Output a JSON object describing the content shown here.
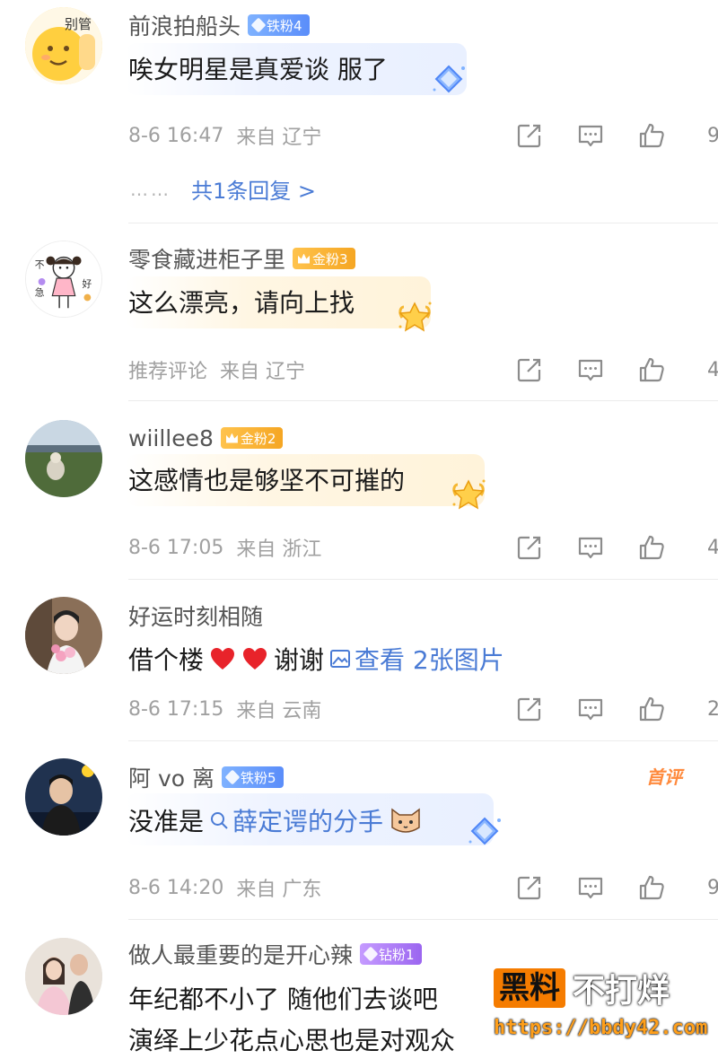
{
  "comments": [
    {
      "username": "前浪拍船头",
      "badge": "铁粉4",
      "badge_color": "#5a8dfa",
      "text": "唉女明星是真爱谈 服了",
      "time": "8-6 16:47",
      "location": "来自 辽宁",
      "likes": "9",
      "replies": "共1条回复 >",
      "replies_dots": "……",
      "avatar_text": "别管"
    },
    {
      "username": "零食藏进柜子里",
      "badge": "金粉3",
      "badge_color": "#f5a623",
      "text": "这么漂亮，请向上找",
      "time": "推荐评论",
      "location": "来自 辽宁",
      "likes": "4"
    },
    {
      "username": "wiillee8",
      "badge": "金粉2",
      "badge_color": "#f5a623",
      "text": "这感情也是够坚不可摧的",
      "time": "8-6 17:05",
      "location": "来自 浙江",
      "likes": "4"
    },
    {
      "username": "好运时刻相随",
      "text_prefix": "借个楼",
      "text_suffix": "谢谢",
      "image_link": "查看 2张图片",
      "time": "8-6 17:15",
      "location": "来自 云南",
      "likes": "2"
    },
    {
      "username": "阿 vo 离",
      "badge": "铁粉5",
      "badge_color": "#5a8dfa",
      "text_prefix": "没准是",
      "search_link": "薛定谔的分手",
      "first_tag": "首评",
      "time": "8-6 14:20",
      "location": "来自 广东",
      "likes": "9"
    },
    {
      "username": "做人最重要的是开心辣",
      "badge": "钻粉1",
      "badge_color": "#9b66f0",
      "text_line1": "年纪都不小了 随他们去谈吧",
      "text_line2": "演绎上少花点心思也是对观众"
    }
  ],
  "watermark": {
    "box": "黑料",
    "text": "不打烊",
    "url": "https://bbdy42.com"
  },
  "icons": [
    "share-icon",
    "comment-icon",
    "like-icon"
  ]
}
